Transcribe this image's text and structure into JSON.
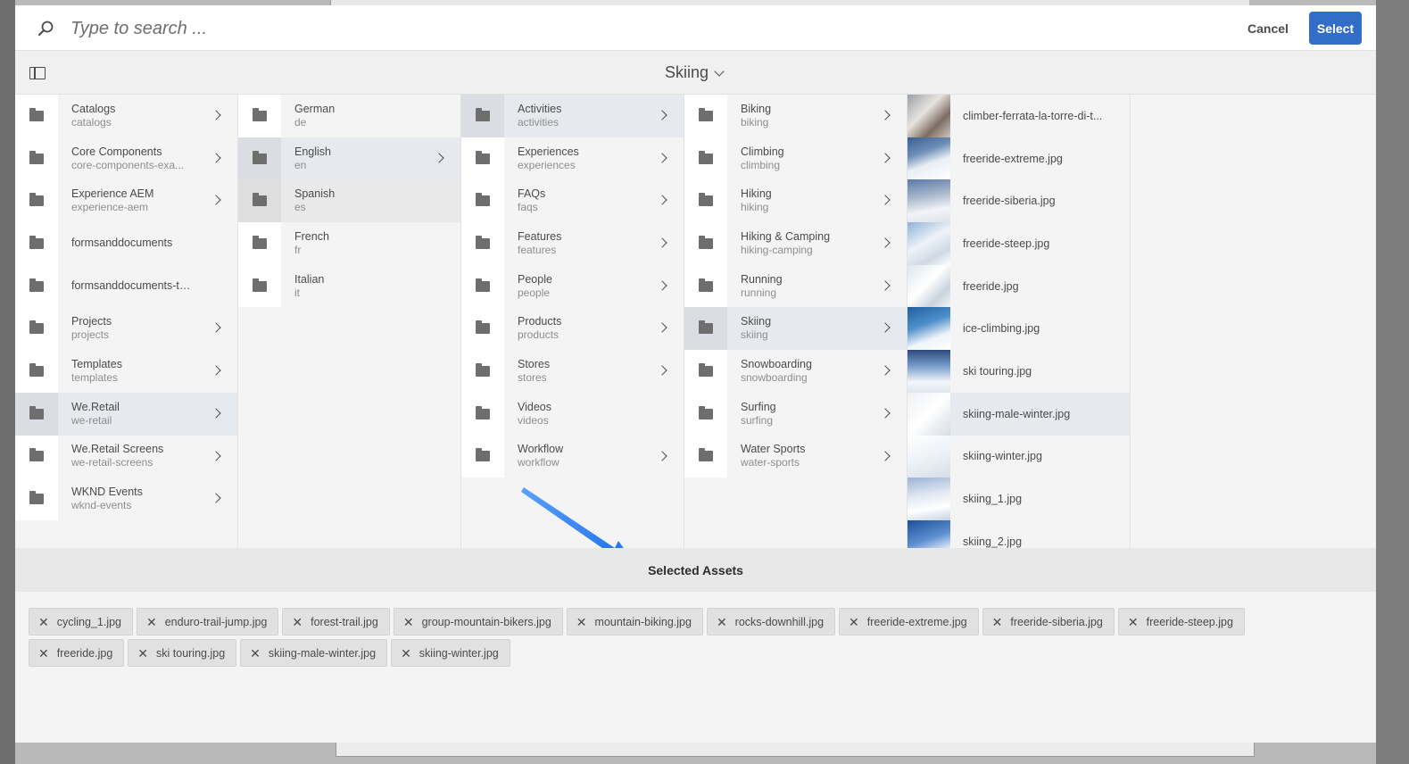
{
  "header": {
    "search_placeholder": "Type to search ...",
    "cancel_label": "Cancel",
    "select_label": "Select"
  },
  "toolbar": {
    "breadcrumb": "Skiing"
  },
  "columns": {
    "col1": [
      {
        "name": "Catalogs",
        "sub": "catalogs",
        "chevron": true
      },
      {
        "name": "Core Components",
        "sub": "core-components-exa...",
        "chevron": true
      },
      {
        "name": "Experience AEM",
        "sub": "experience-aem",
        "chevron": true
      },
      {
        "name": "formsanddocuments",
        "sub": "",
        "chevron": false
      },
      {
        "name": "formsanddocuments-themes",
        "sub": "",
        "chevron": false
      },
      {
        "name": "Projects",
        "sub": "projects",
        "chevron": true
      },
      {
        "name": "Templates",
        "sub": "templates",
        "chevron": true
      },
      {
        "name": "We.Retail",
        "sub": "we-retail",
        "chevron": true
      },
      {
        "name": "We.Retail Screens",
        "sub": "we-retail-screens",
        "chevron": true
      },
      {
        "name": "WKND Events",
        "sub": "wknd-events",
        "chevron": true
      }
    ],
    "col2": [
      {
        "name": "German",
        "sub": "de",
        "chevron": false
      },
      {
        "name": "English",
        "sub": "en",
        "chevron": true
      },
      {
        "name": "Spanish",
        "sub": "es",
        "chevron": false
      },
      {
        "name": "French",
        "sub": "fr",
        "chevron": false
      },
      {
        "name": "Italian",
        "sub": "it",
        "chevron": false
      }
    ],
    "col3": [
      {
        "name": "Activities",
        "sub": "activities",
        "chevron": true
      },
      {
        "name": "Experiences",
        "sub": "experiences",
        "chevron": true
      },
      {
        "name": "FAQs",
        "sub": "faqs",
        "chevron": true
      },
      {
        "name": "Features",
        "sub": "features",
        "chevron": true
      },
      {
        "name": "People",
        "sub": "people",
        "chevron": true
      },
      {
        "name": "Products",
        "sub": "products",
        "chevron": true
      },
      {
        "name": "Stores",
        "sub": "stores",
        "chevron": true
      },
      {
        "name": "Videos",
        "sub": "videos",
        "chevron": false
      },
      {
        "name": "Workflow",
        "sub": "workflow",
        "chevron": true
      }
    ],
    "col4": [
      {
        "name": "Biking",
        "sub": "biking",
        "chevron": true
      },
      {
        "name": "Climbing",
        "sub": "climbing",
        "chevron": true
      },
      {
        "name": "Hiking",
        "sub": "hiking",
        "chevron": true
      },
      {
        "name": "Hiking & Camping",
        "sub": "hiking-camping",
        "chevron": true
      },
      {
        "name": "Running",
        "sub": "running",
        "chevron": true
      },
      {
        "name": "Skiing",
        "sub": "skiing",
        "chevron": true
      },
      {
        "name": "Snowboarding",
        "sub": "snowboarding",
        "chevron": true
      },
      {
        "name": "Surfing",
        "sub": "surfing",
        "chevron": true
      },
      {
        "name": "Water Sports",
        "sub": "water-sports",
        "chevron": true
      }
    ],
    "assets": [
      {
        "name": "climber-ferrata-la-torre-di-t..."
      },
      {
        "name": "freeride-extreme.jpg"
      },
      {
        "name": "freeride-siberia.jpg"
      },
      {
        "name": "freeride-steep.jpg"
      },
      {
        "name": "freeride.jpg"
      },
      {
        "name": "ice-climbing.jpg"
      },
      {
        "name": "ski touring.jpg"
      },
      {
        "name": "skiing-male-winter.jpg"
      },
      {
        "name": "skiing-winter.jpg"
      },
      {
        "name": "skiing_1.jpg"
      },
      {
        "name": "skiing_2.jpg"
      }
    ]
  },
  "selected": {
    "title": "Selected Assets",
    "chips": [
      "cycling_1.jpg",
      "enduro-trail-jump.jpg",
      "forest-trail.jpg",
      "group-mountain-bikers.jpg",
      "mountain-biking.jpg",
      "rocks-downhill.jpg",
      "freeride-extreme.jpg",
      "freeride-siberia.jpg",
      "freeride-steep.jpg",
      "freeride.jpg",
      "ski touring.jpg",
      "skiing-male-winter.jpg",
      "skiing-winter.jpg"
    ]
  },
  "colors": {
    "accent": "#326ec8",
    "arrow": "#2f80ed",
    "selected_row": "#e6e9ee"
  }
}
